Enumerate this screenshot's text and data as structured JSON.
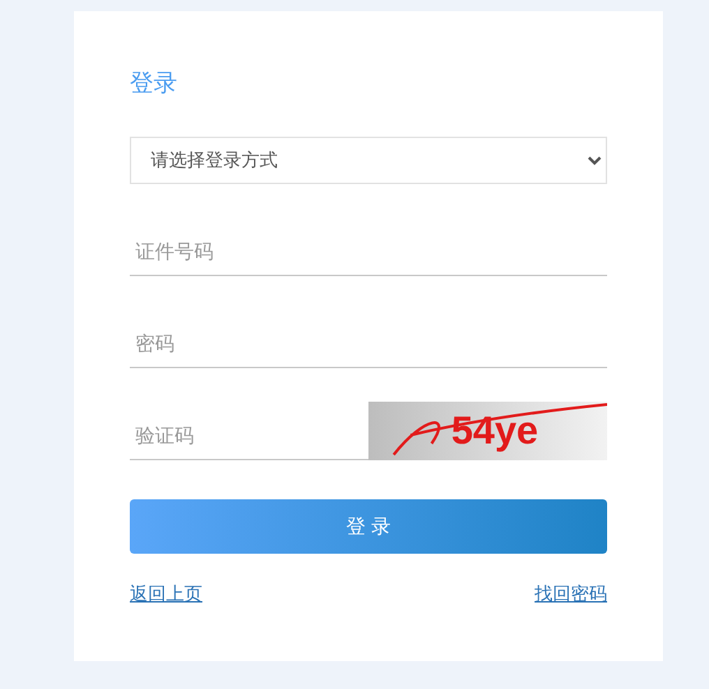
{
  "title": "登录",
  "login_method": {
    "placeholder": "请选择登录方式"
  },
  "fields": [
    {
      "kind": "text",
      "placeholder": "证件号码"
    },
    {
      "kind": "password",
      "placeholder": "密码"
    },
    {
      "kind": "captcha",
      "placeholder": "验证码",
      "captcha": "54ye"
    }
  ],
  "submit": "登 录",
  "links": [
    "返回上页",
    "找回密码"
  ]
}
